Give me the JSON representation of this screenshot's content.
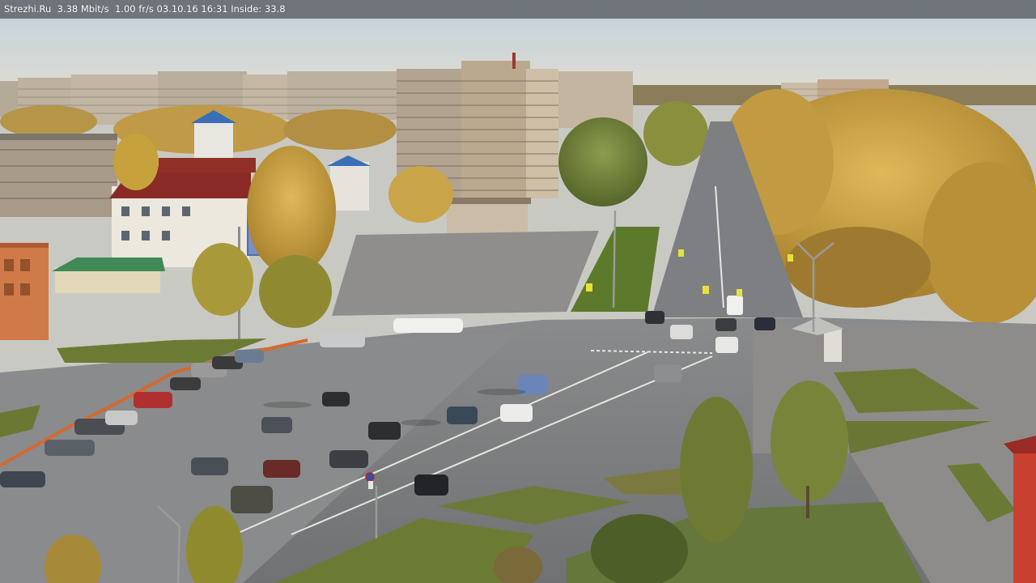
{
  "overlay": {
    "text": "Strezhi.Ru  3.38 Mbit/s  1.00 fr/s 03.10.16 16:31 Inside: 33.8"
  },
  "scene": {
    "description_hidden": "",
    "palette": {
      "sky_top": "#c4d2de",
      "sky_horizon": "#dcdcd2",
      "asphalt": "#7c7e80",
      "plaza": "#8b8a88",
      "grass": "#6f7a3a",
      "foliage_yellow": "#c9a34a",
      "foliage_green": "#6f8a3c",
      "building_panel": "#b8ac9c",
      "roof_red": "#8a2a26",
      "roof_blue": "#3a6fb8"
    },
    "icons": {
      "traffic_sign": "pedestrian-crossing-icon",
      "no_stopping": "no-stopping-sign-icon"
    }
  }
}
